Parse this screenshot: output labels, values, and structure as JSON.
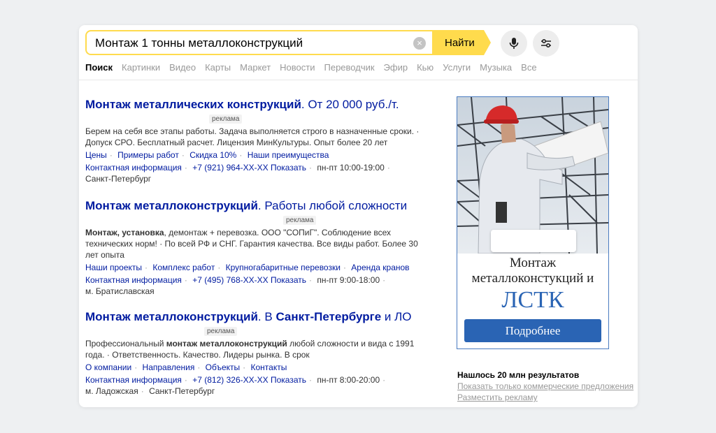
{
  "search": {
    "query": "Монтаж 1 тонны металлоконструкций",
    "clear_icon": "×",
    "find_label": "Найти"
  },
  "tabs": [
    {
      "label": "Поиск"
    },
    {
      "label": "Картинки"
    },
    {
      "label": "Видео"
    },
    {
      "label": "Карты"
    },
    {
      "label": "Маркет"
    },
    {
      "label": "Новости"
    },
    {
      "label": "Переводчик"
    },
    {
      "label": "Эфир"
    },
    {
      "label": "Кью"
    },
    {
      "label": "Услуги"
    },
    {
      "label": "Музыка"
    },
    {
      "label": "Все"
    }
  ],
  "results": [
    {
      "title_bold": "Монтаж металлических конструкций",
      "title_rest": ". От 20 000 руб./т.",
      "ad": "реклама",
      "desc": "Берем на себя все этапы работы. Задача выполняется строго в назначенные сроки. · Допуск СРО. Бесплатный расчет. Лицензия МинКультуры. Опыт более 20 лет",
      "links": [
        "Цены",
        "Примеры работ",
        "Скидка 10%",
        "Наши преимущества"
      ],
      "contact": "Контактная информация",
      "phone": "+7 (921) 964-XX-XX Показать",
      "hours": "пн-пт 10:00-19:00",
      "address": "Санкт-Петербург"
    },
    {
      "title_bold": "Монтаж металлоконструкций",
      "title_rest": ". Работы любой сложности",
      "ad": "реклама",
      "desc_bold": "Монтаж, установка",
      "desc": ", демонтаж + перевозка. ООО \"СОПиГ\". Соблюдение всех технических норм! · По всей РФ и СНГ. Гарантия качества. Все виды работ. Более 30 лет опыта",
      "links": [
        "Наши проекты",
        "Комплекс работ",
        "Крупногабаритные перевозки",
        "Аренда кранов"
      ],
      "contact": "Контактная информация",
      "phone": "+7 (495) 768-XX-XX Показать",
      "hours": "пн-пт 9:00-18:00",
      "address": "м. Братиславская"
    },
    {
      "title_bold": "Монтаж металлоконструкций",
      "title_mid": ". В ",
      "title_bold2": "Санкт-Петербурге",
      "title_rest": " и ЛО",
      "ad": "реклама",
      "desc_pre": "Профессиональный ",
      "desc_bold": "монтаж металлоконструкций",
      "desc": " любой сложности и вида с 1991 года. · Ответственность. Качество. Лидеры рынка. В срок",
      "links": [
        "О компании",
        "Направления",
        "Объекты",
        "Контакты"
      ],
      "contact": "Контактная информация",
      "phone": "+7 (812) 326-XX-XX Показать",
      "hours": "пн-пт 8:00-20:00",
      "address": "м. Ладожская",
      "address2": "Санкт-Петербург"
    }
  ],
  "banner": {
    "line1": "Монтаж",
    "line2": "металлоконстукций и",
    "line3": "ЛСТК",
    "button": "Подробнее"
  },
  "sidebar": {
    "found": "Нашлось 20 млн результатов",
    "commercial_link": "Показать только коммерческие предложения",
    "advertise_link": "Разместить рекламу"
  },
  "colors": {
    "accent": "#ffdb4d",
    "link": "#001ba0",
    "banner_blue": "#2a64b4"
  }
}
